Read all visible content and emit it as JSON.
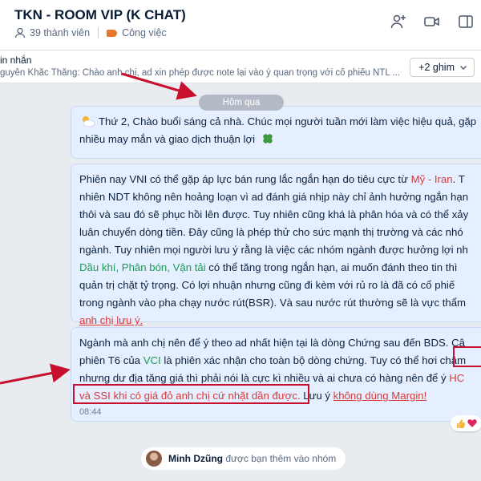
{
  "header": {
    "title": "TKN - ROOM VIP (K CHAT)",
    "members": "39 thành viên",
    "tag": "Công việc"
  },
  "pinned": {
    "title": "in nhắn",
    "preview": "guyễn Khắc Thắng: Chào anh chị, ad xin phép được note lại vào ý quan trọng với cổ phiếu NTL ...",
    "more_button": "+2 ghim"
  },
  "date_separator": "Hôm qua",
  "messages": {
    "m1": {
      "l1": "Thứ 2, Chào buổi sáng cả nhà. Chúc mọi người tuần mới làm việc hiệu quả, gặp",
      "l2": "nhiều may mắn và giao dịch thuận lợi"
    },
    "m2": {
      "l1a": "Phiên nay VNI có thể gặp áp lực bán rung lắc ngắn hạn do tiêu cực từ ",
      "l1b": "Mỹ - Iran",
      "l1c": ". T",
      "l2": "nhiên NDT không nên hoảng loạn vì ad đánh giá nhịp này chỉ ảnh hưởng ngắn hạn",
      "l3": "thôi và sau đó sẽ phục hồi lên được. Tuy nhiên cũng khá là phân hóa và có thể xảy",
      "l4": "luân chuyển dòng tiền. Đây cũng là phép thử cho sức mạnh thị trường và các nhó",
      "l5": "ngành. Tuy nhiên mọi người lưu ý rằng là việc các nhóm ngành được hưởng lợi nh",
      "l6a": "Dầu khí, Phân bón, Vận tải",
      "l6b": " có thể tăng trong ngắn hạn, ai muốn đánh theo tin thì",
      "l7": "quản trị chặt tỷ trọng. Có lợi nhuận nhưng cũng đi kèm với rủ ro là đã có cổ phiế",
      "l8": "trong ngành vào pha chạy nước rút(BSR). Và sau nước rút thường sẽ là vực thẩm",
      "l9": "anh chị lưu ý."
    },
    "m3": {
      "l1": "Ngành mà anh chị nên để ý theo ad nhất hiện tại là dòng Chứng sau đến BDS. Câ",
      "l2a": "phiên T6 của ",
      "l2b": "VCI",
      "l2c": " là phiên xác nhận cho toàn bộ dòng chứng. Tuy có thể hơi chậm",
      "l3a": "nhưng dư địa tăng giá thì phải nói là cực kì nhiều và ai chưa có hàng nên để ý ",
      "l3b": "HC",
      "l4a": "và SSI",
      "l4b": " khi có giá đỏ anh chị cứ nhặt dần được.",
      "l4c": " Lưu ý ",
      "l4d": "không dùng Margin!",
      "time": "08:44"
    }
  },
  "system_notice": {
    "name": "Minh Dzũng",
    "text": " được bạn thêm vào nhóm"
  },
  "colors": {
    "bubble": "#e5efff",
    "accent_red": "#d83a3a",
    "accent_green": "#1e9a57",
    "annotation_red": "#c8102e"
  }
}
